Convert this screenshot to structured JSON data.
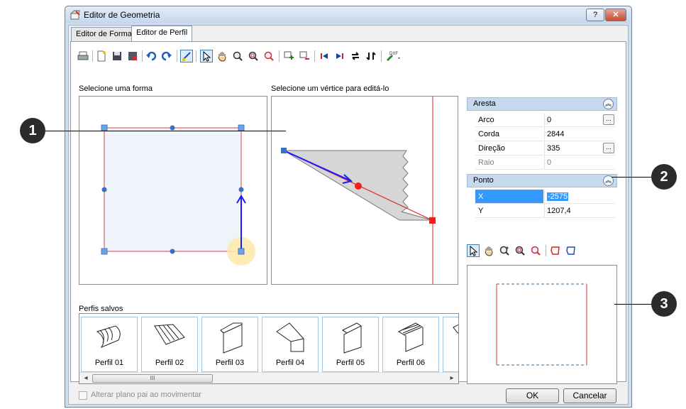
{
  "window": {
    "title": "Editor de Geometria",
    "help_label": "?",
    "close_label": "✕"
  },
  "tabs": [
    {
      "label": "Editor de Forma",
      "active": false
    },
    {
      "label": "Editor de Perfil",
      "active": true
    }
  ],
  "shape_panel": {
    "label": "Selecione uma forma"
  },
  "vertex_panel": {
    "label": "Selecione um vértice para editá-lo"
  },
  "properties": {
    "aresta": {
      "header": "Aresta",
      "rows": [
        {
          "name": "Arco",
          "value": "0",
          "ellipsis": true
        },
        {
          "name": "Corda",
          "value": "2844",
          "ellipsis": false
        },
        {
          "name": "Direção",
          "value": "335",
          "ellipsis": true
        },
        {
          "name": "Raio",
          "value": "0",
          "ellipsis": false
        }
      ]
    },
    "ponto": {
      "header": "Ponto",
      "rows": [
        {
          "name": "X",
          "value": "-2575"
        },
        {
          "name": "Y",
          "value": "1207,4"
        }
      ]
    },
    "ellipsis_label": "..."
  },
  "saved_profiles": {
    "label": "Perfis salvos",
    "items": [
      "Perfil 01",
      "Perfil 02",
      "Perfil 03",
      "Perfil 04",
      "Perfil 05",
      "Perfil 06"
    ],
    "scroll_thumb_label": "III",
    "scroll_left": "◂",
    "scroll_right": "▸"
  },
  "footer": {
    "checkbox_label": "Alterar plano pai ao movimentar",
    "ok_label": "OK",
    "cancel_label": "Cancelar"
  },
  "callouts": {
    "c1": "1",
    "c2": "2",
    "c3": "3"
  },
  "colors": {
    "selection": "#3399ff",
    "profile_line": "#e03030",
    "vertex_blue": "#1a1aff",
    "dashed_blue": "#3a6d9a"
  }
}
